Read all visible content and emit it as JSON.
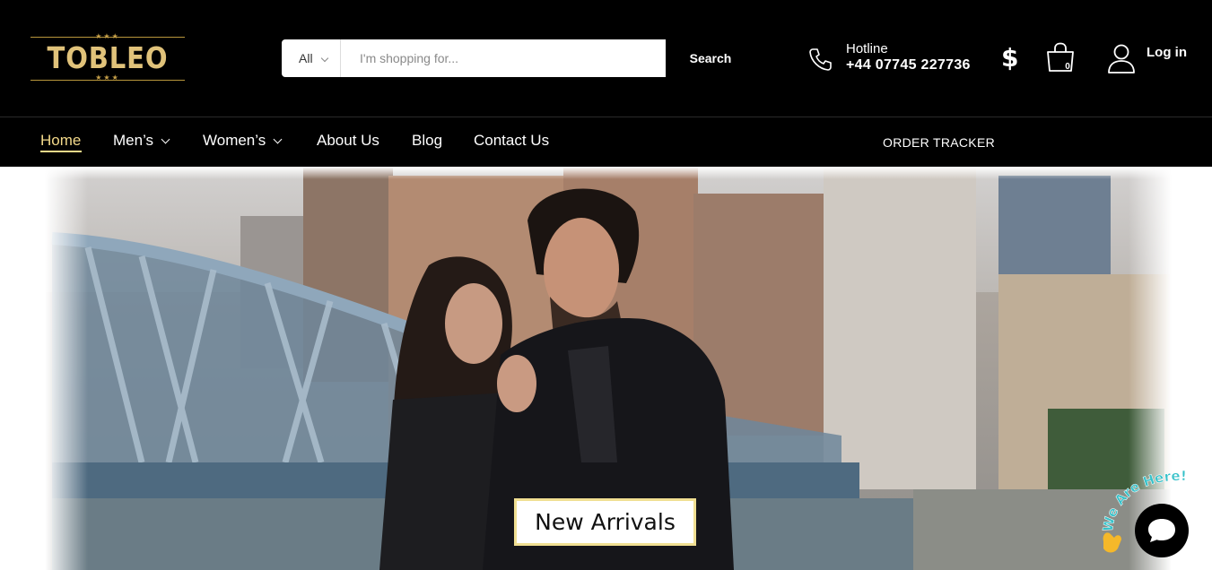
{
  "header": {
    "logo": {
      "text": "TOBLEO",
      "stars": "★★★"
    },
    "search": {
      "category": "All",
      "placeholder": "I'm shopping for...",
      "button_label": "Search"
    },
    "hotline": {
      "label": "Hotline",
      "number": "+44 07745 227736"
    },
    "currency_symbol": "$",
    "cart_count": "0",
    "login_label": "Log in"
  },
  "nav": {
    "items": [
      {
        "label": "Home",
        "active": true
      },
      {
        "label": "Men’s",
        "dropdown": true
      },
      {
        "label": "Women’s",
        "dropdown": true
      },
      {
        "label": "About Us"
      },
      {
        "label": "Blog"
      },
      {
        "label": "Contact Us"
      }
    ],
    "order_tracker": "ORDER TRACKER"
  },
  "hero": {
    "cta_label": "New Arrivals"
  },
  "chat": {
    "badge_text": "We Are Here!"
  },
  "colors": {
    "header_bg": "#000000",
    "accent_gold": "#f3d98a",
    "logo_gold": "#e0c27a"
  }
}
